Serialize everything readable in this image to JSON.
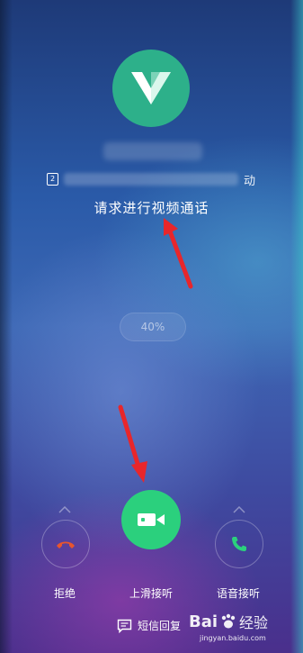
{
  "caller": {
    "sim_slot": "2",
    "number_suffix": "动",
    "status_text": "请求进行视频通话"
  },
  "battery_pill": {
    "text": "40%"
  },
  "actions": {
    "decline_label": "拒绝",
    "accept_label": "上滑接听",
    "voice_label": "语音接听",
    "sms_label": "短信回复"
  },
  "colors": {
    "avatar": "#2db08a",
    "accept": "#2bd07d",
    "decline_icon": "#e8552e",
    "voice_icon": "#2bd07d",
    "annotation_arrow": "#e8262b"
  },
  "icons": {
    "avatar": "triangle-logo-icon",
    "sim": "sim-2-icon",
    "accept": "video-camera-icon",
    "decline": "hang-up-icon",
    "voice": "phone-icon",
    "sms": "message-icon",
    "chevrons": "chevron-up-icon"
  },
  "watermark": {
    "brand": "Bai",
    "brand2": "经验",
    "site": "jingyan.baidu.com"
  }
}
